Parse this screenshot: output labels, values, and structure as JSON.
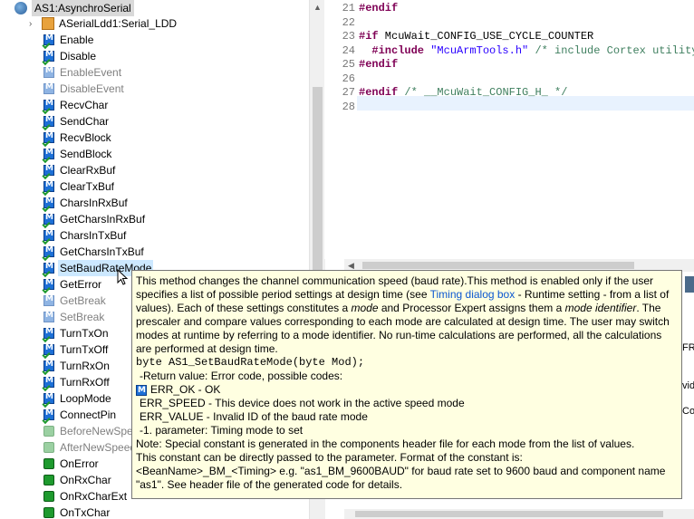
{
  "tree": {
    "root": {
      "label": "AS1:AsynchroSerial"
    },
    "child": {
      "label": "ASerialLdd1:Serial_LDD"
    },
    "items": [
      {
        "label": "Enable",
        "kind": "method",
        "enabled": true
      },
      {
        "label": "Disable",
        "kind": "method",
        "enabled": true
      },
      {
        "label": "EnableEvent",
        "kind": "method",
        "enabled": false
      },
      {
        "label": "DisableEvent",
        "kind": "method",
        "enabled": false
      },
      {
        "label": "RecvChar",
        "kind": "method",
        "enabled": true
      },
      {
        "label": "SendChar",
        "kind": "method",
        "enabled": true
      },
      {
        "label": "RecvBlock",
        "kind": "method",
        "enabled": true
      },
      {
        "label": "SendBlock",
        "kind": "method",
        "enabled": true
      },
      {
        "label": "ClearRxBuf",
        "kind": "method",
        "enabled": true
      },
      {
        "label": "ClearTxBuf",
        "kind": "method",
        "enabled": true
      },
      {
        "label": "CharsInRxBuf",
        "kind": "method",
        "enabled": true
      },
      {
        "label": "GetCharsInRxBuf",
        "kind": "method",
        "enabled": true
      },
      {
        "label": "CharsInTxBuf",
        "kind": "method",
        "enabled": true
      },
      {
        "label": "GetCharsInTxBuf",
        "kind": "method",
        "enabled": true
      },
      {
        "label": "SetBaudRateMode",
        "kind": "method",
        "enabled": true,
        "selected": true
      },
      {
        "label": "GetError",
        "kind": "method",
        "enabled": true
      },
      {
        "label": "GetBreak",
        "kind": "method",
        "enabled": false
      },
      {
        "label": "SetBreak",
        "kind": "method",
        "enabled": false
      },
      {
        "label": "TurnTxOn",
        "kind": "method",
        "enabled": true
      },
      {
        "label": "TurnTxOff",
        "kind": "method",
        "enabled": true
      },
      {
        "label": "TurnRxOn",
        "kind": "method",
        "enabled": true
      },
      {
        "label": "TurnRxOff",
        "kind": "method",
        "enabled": true
      },
      {
        "label": "LoopMode",
        "kind": "method",
        "enabled": true
      },
      {
        "label": "ConnectPin",
        "kind": "method",
        "enabled": true
      },
      {
        "label": "BeforeNewSpeed",
        "kind": "event",
        "enabled": false
      },
      {
        "label": "AfterNewSpeed",
        "kind": "event",
        "enabled": false
      },
      {
        "label": "OnError",
        "kind": "event",
        "enabled": true
      },
      {
        "label": "OnRxChar",
        "kind": "event",
        "enabled": true
      },
      {
        "label": "OnRxCharExt",
        "kind": "event",
        "enabled": true
      },
      {
        "label": "OnTxChar",
        "kind": "event",
        "enabled": true
      }
    ]
  },
  "editor": {
    "lines": [
      {
        "num": "21",
        "parts": [
          {
            "t": "#endif",
            "c": "kw"
          }
        ]
      },
      {
        "num": "22",
        "parts": []
      },
      {
        "num": "23",
        "parts": [
          {
            "t": "#if",
            "c": "kw"
          },
          {
            "t": " McuWait_CONFIG_USE_CYCLE_COUNTER",
            "c": ""
          }
        ]
      },
      {
        "num": "24",
        "parts": [
          {
            "t": "  #include",
            "c": "kw"
          },
          {
            "t": " ",
            "c": ""
          },
          {
            "t": "\"McuArmTools.h\"",
            "c": "str"
          },
          {
            "t": " /* include Cortex utility",
            "c": "cm"
          }
        ]
      },
      {
        "num": "25",
        "parts": [
          {
            "t": "#endif",
            "c": "kw"
          }
        ]
      },
      {
        "num": "26",
        "parts": []
      },
      {
        "num": "27",
        "parts": [
          {
            "t": "#endif",
            "c": "kw"
          },
          {
            "t": " /* __McuWait_CONFIG_H_ */",
            "c": "cm"
          }
        ]
      },
      {
        "num": "28",
        "parts": []
      }
    ]
  },
  "side_fragments": {
    "fr": "FR",
    "vid": "vid",
    "ov": "Cov"
  },
  "tooltip": {
    "p1_a": "This method changes the channel communication speed (baud rate).This method is enabled only if the user specifies a list of possible period settings at design time (see ",
    "p1_link": "Timing dialog box",
    "p1_b": " -  Runtime setting - from a list of values). Each of these settings constitutes a ",
    "p1_em1": "mode",
    "p1_c": " and Processor Expert assigns them a ",
    "p1_em2": "mode identifier",
    "p1_d": ". The prescaler and compare values corresponding to each mode are calculated at design time. The user may switch modes at runtime by referring to a mode identifier. No run-time calculations are performed, all the calculations are performed at design time.",
    "signature": "byte AS1_SetBaudRateMode(byte Mod);",
    "ret": "-Return value: Error code, possible codes:",
    "err_ok": "ERR_OK - OK",
    "err_speed": "ERR_SPEED - This device does not work in the active speed mode",
    "err_value": "ERR_VALUE - Invalid ID of the baud rate mode",
    "param": "-1. parameter: Timing mode to set",
    "note": "Note: Special constant is generated in the components header file for each mode from the list of values.",
    "note2": "This constant can be directly passed to the parameter. Format of the constant is:",
    "note3": "<BeanName>_BM_<Timing> e.g. \"as1_BM_9600BAUD\" for baud rate set to 9600 baud and component name \"as1\". See header file of the generated code for details."
  },
  "colors": {
    "tooltip_bg": "#ffffe1",
    "keyword": "#7f0055",
    "string": "#2a00ff",
    "comment": "#3f7f5f",
    "link": "#0b57d0",
    "method_icon": "#1d6fd6",
    "event_icon": "#1e9a2e"
  }
}
